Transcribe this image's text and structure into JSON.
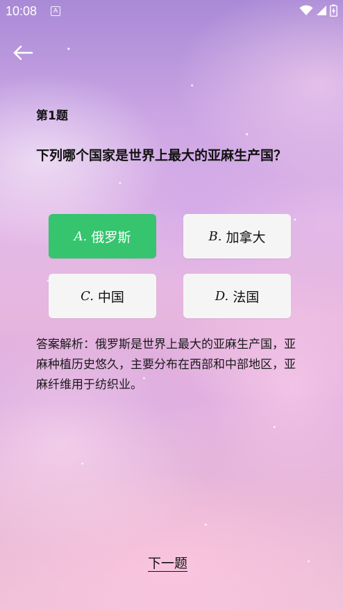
{
  "status_bar": {
    "time": "10:08",
    "app_icon_letter": "A"
  },
  "header": {
    "back_icon": "arrow-left-icon"
  },
  "question": {
    "number_label": "第1题",
    "text": "下列哪个国家是世界上最大的亚麻生产国？"
  },
  "options": [
    {
      "letter": "A.",
      "text": "俄罗斯",
      "selected": true
    },
    {
      "letter": "B.",
      "text": "加拿大",
      "selected": false
    },
    {
      "letter": "C.",
      "text": "中国",
      "selected": false
    },
    {
      "letter": "D.",
      "text": "法国",
      "selected": false
    }
  ],
  "analysis": {
    "text": "答案解析：俄罗斯是世界上最大的亚麻生产国，亚麻种植历史悠久，主要分布在西部和中部地区，亚麻纤维用于纺织业。"
  },
  "footer": {
    "next_label": "下一题"
  },
  "colors": {
    "selected_option": "#36c46f",
    "option_bg": "#f5f5f5"
  }
}
